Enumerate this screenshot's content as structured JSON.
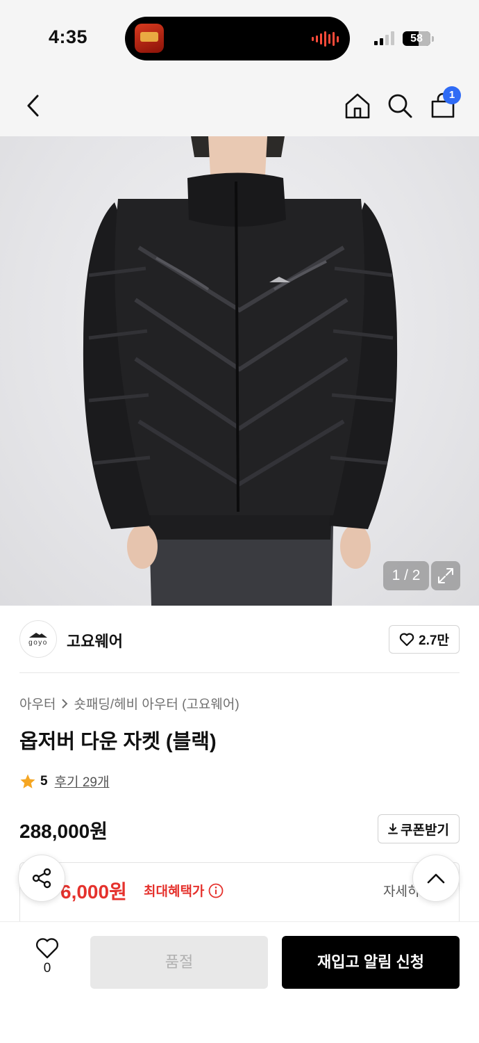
{
  "status_bar": {
    "time": "4:35",
    "battery": "58",
    "signal_bars_active": 2
  },
  "nav": {
    "cart_count": "1",
    "icons": [
      "back-icon",
      "home-icon",
      "search-icon",
      "cart-icon"
    ]
  },
  "gallery": {
    "counter": "1 / 2",
    "current": 1,
    "total": 2
  },
  "brand": {
    "logo_text": "goyo",
    "name": "고요웨어",
    "likes": "2.7만"
  },
  "product": {
    "breadcrumb": [
      "아우터",
      "숏패딩/헤비 아우터 (고요웨어)"
    ],
    "title": "옵저버 다운 자켓 (블랙)",
    "rating": "5",
    "review_link": "후기 29개",
    "price": "288,000원",
    "coupon_label": "쿠폰받기"
  },
  "benefit": {
    "price": "6,000원",
    "label": "최대혜택가",
    "detail": "자세히"
  },
  "bottom_bar": {
    "wish_count": "0",
    "soldout_label": "품절",
    "restock_label": "재입고 알림 신청"
  },
  "colors": {
    "accent_red": "#e5322d",
    "badge_blue": "#2f6bf5",
    "star": "#f5a623"
  }
}
